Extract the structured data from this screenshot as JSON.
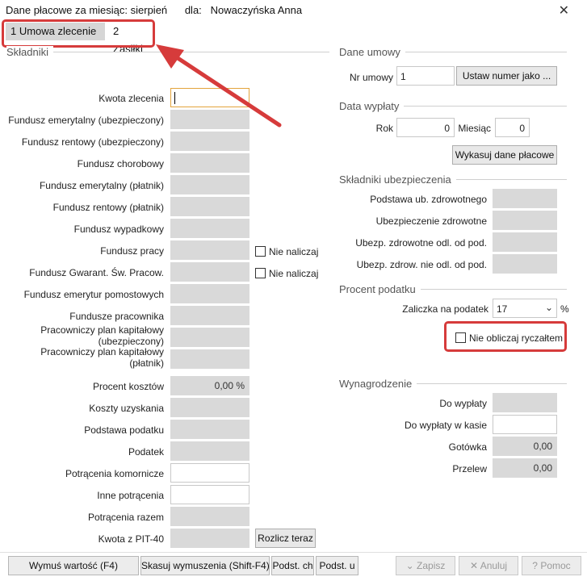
{
  "title": {
    "main": "Dane płacowe za miesiąc: sierpień",
    "for_label": "dla:",
    "employee": "Nowaczyńska Anna"
  },
  "tabs": [
    {
      "label": "1 Umowa zlecenie",
      "active": true
    },
    {
      "label": "2 Zasiłki",
      "active": false
    }
  ],
  "left": {
    "section_title": "Składniki",
    "rows": [
      {
        "label": "Kwota zlecenia",
        "value": ""
      },
      {
        "label": "Fundusz emerytalny (ubezpieczony)",
        "value": ""
      },
      {
        "label": "Fundusz rentowy (ubezpieczony)",
        "value": ""
      },
      {
        "label": "Fundusz chorobowy",
        "value": ""
      },
      {
        "label": "Fundusz emerytalny (płatnik)",
        "value": ""
      },
      {
        "label": "Fundusz rentowy (płatnik)",
        "value": ""
      },
      {
        "label": "Fundusz wypadkowy",
        "value": ""
      },
      {
        "label": "Fundusz pracy",
        "value": ""
      },
      {
        "label": "Fundusz Gwarant. Św. Pracow.",
        "value": ""
      },
      {
        "label": "Fundusz emerytur pomostowych",
        "value": ""
      },
      {
        "label": "Fundusze pracownika",
        "value": ""
      },
      {
        "label": "Pracowniczy plan kapitałowy (ubezpieczony)",
        "value": ""
      },
      {
        "label": "Pracowniczy plan kapitałowy (płatnik)",
        "value": ""
      },
      {
        "label": "Procent kosztów",
        "value": "0,00 %"
      },
      {
        "label": "Koszty uzyskania",
        "value": ""
      },
      {
        "label": "Podstawa podatku",
        "value": ""
      },
      {
        "label": "Podatek",
        "value": ""
      },
      {
        "label": "Potrącenia komornicze",
        "value": ""
      },
      {
        "label": "Inne potrącenia",
        "value": ""
      },
      {
        "label": "Potrącenia razem",
        "value": ""
      },
      {
        "label": "Kwota z PIT-40",
        "value": ""
      }
    ],
    "nie_naliczaj_1": "Nie naliczaj",
    "nie_naliczaj_2": "Nie naliczaj",
    "rozlicz_button": "Rozlicz teraz"
  },
  "right": {
    "umowy": {
      "section_title": "Dane umowy",
      "nr_label": "Nr umowy",
      "nr_value": "1",
      "set_button": "Ustaw numer jako ..."
    },
    "wyplaty": {
      "section_title": "Data wypłaty",
      "rok_label": "Rok",
      "rok_value": "0",
      "miesiac_label": "Miesiąc",
      "miesiac_value": "0",
      "clear_button": "Wykasuj dane płacowe"
    },
    "ubezp": {
      "section_title": "Składniki ubezpieczenia",
      "rows": [
        {
          "label": "Podstawa ub. zdrowotnego",
          "value": ""
        },
        {
          "label": "Ubezpieczenie zdrowotne",
          "value": ""
        },
        {
          "label": "Ubezp. zdrowotne odl. od pod.",
          "value": ""
        },
        {
          "label": "Ubezp. zdrow. nie odl. od pod.",
          "value": ""
        }
      ]
    },
    "podatek": {
      "section_title": "Procent podatku",
      "zaliczka_label": "Zaliczka na podatek",
      "zaliczka_value": "17",
      "percent_sign": "%",
      "ryczalt_label": "Nie obliczaj ryczałtem"
    },
    "wynagrodzenie": {
      "section_title": "Wynagrodzenie",
      "rows": [
        {
          "label": "Do wypłaty",
          "value": ""
        },
        {
          "label": "Do wypłaty w kasie",
          "value": ""
        },
        {
          "label": "Gotówka",
          "value": "0,00"
        },
        {
          "label": "Przelew",
          "value": "0,00"
        }
      ]
    }
  },
  "bottom": {
    "wymus": "Wymuś wartość (F4)",
    "skasuj": "Skasuj wymuszenia (Shift-F4)",
    "podst_ch": "Podst. ch",
    "podst_u": "Podst. u",
    "zapisz": "Zapisz",
    "anuluj": "Anuluj",
    "pomoc": "Pomoc"
  },
  "colors": {
    "annotation_red": "#d63b3b",
    "disabled_field": "#d9d9d9"
  }
}
